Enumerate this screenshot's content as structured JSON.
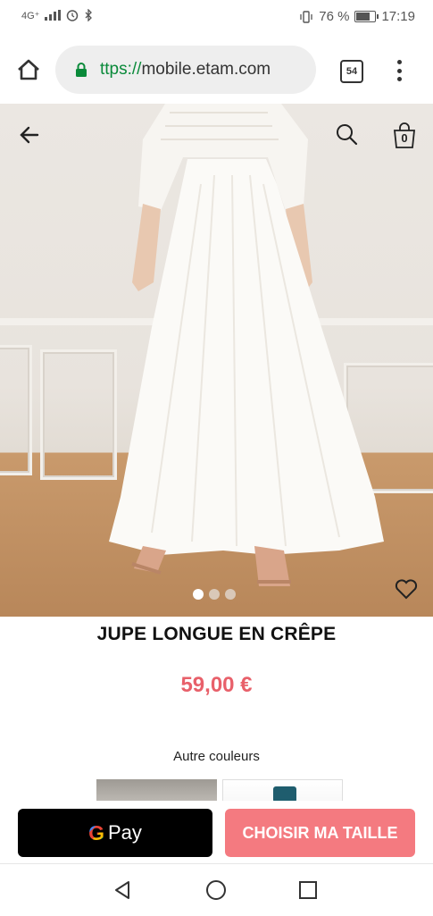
{
  "status_bar": {
    "network": "4G⁺",
    "battery_text": "76 %",
    "time": "17:19"
  },
  "browser": {
    "url_scheme": "ttps://",
    "url_host": "mobile.etam.com",
    "tab_count": "54",
    "icons": [
      "home-icon",
      "lock-icon",
      "tabs-icon",
      "overflow-menu-icon"
    ]
  },
  "product": {
    "cart_count": "0",
    "carousel": {
      "total": 3,
      "active": 1
    },
    "title": "JUPE LONGUE EN CRÊPE",
    "price": "59,00 €",
    "other_colors_label": "Autre couleurs"
  },
  "actions": {
    "gpay_letter": "G",
    "gpay_label": "Pay",
    "choose_size_label": "CHOISIR MA TAILLE"
  },
  "colors": {
    "price": "#e8606a",
    "choose_size_bg": "#f47a80",
    "gpay_bg": "#000000",
    "lock_green": "#0a8a3a"
  }
}
